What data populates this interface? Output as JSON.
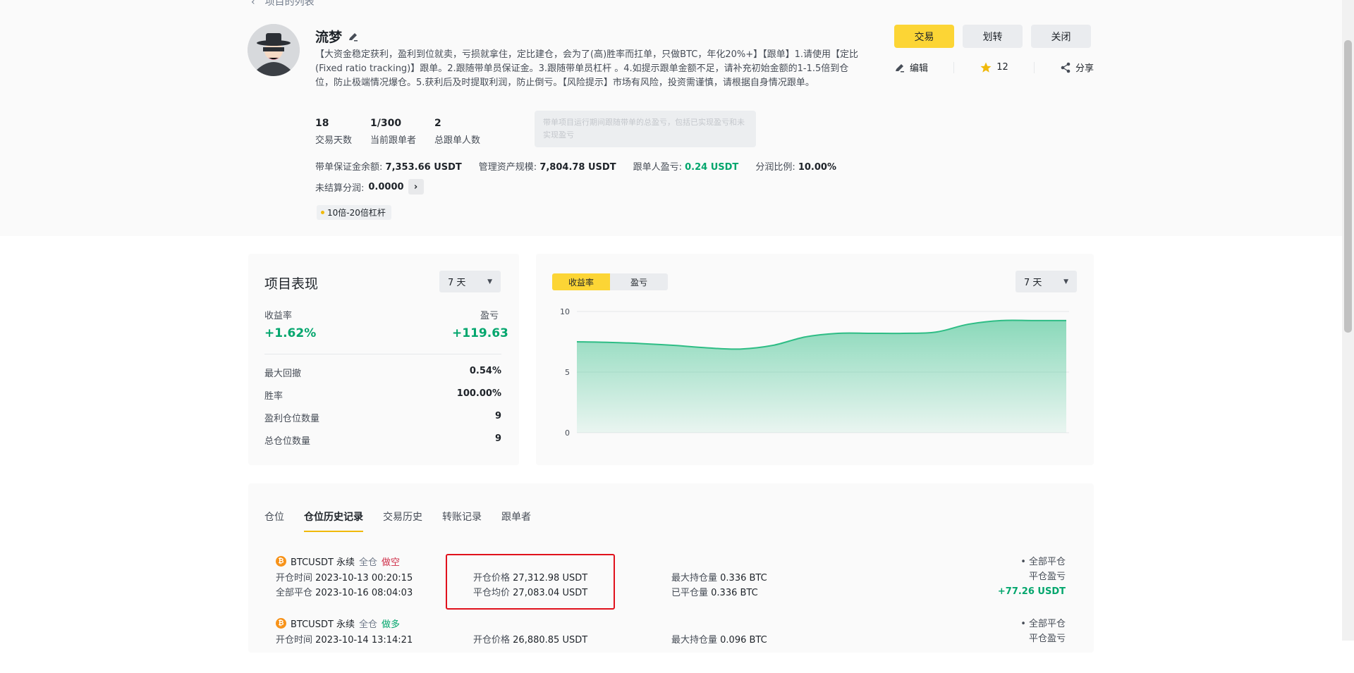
{
  "header": {
    "back_label": "项目的列表"
  },
  "profile": {
    "name": "流梦",
    "description": "【大资金稳定获利，盈利到位就卖，亏损就拿住，定比建仓，会为了(高)胜率而扛单，只做BTC，年化20%+】【跟单】1.请使用【定比(Fixed ratio tracking)】跟单。2.跟随带单员保证金。3.跟随带单员杠杆 。4.如提示跟单金额不足，请补充初始金额的1-1.5倍到仓位，防止极端情况爆仓。5.获利后及时提取利润，防止倒亏。【风险提示】市场有风险，投资需谨慎，请根据自身情况跟单。",
    "stats": [
      {
        "value": "18",
        "label": "交易天数"
      },
      {
        "value": "1/300",
        "label": "当前跟单者"
      },
      {
        "value": "2",
        "label": "总跟单人数"
      }
    ],
    "metrics": {
      "margin_label": "带单保证金余额:",
      "margin_value": "7,353.66 USDT",
      "aum_label": "管理资产规模:",
      "aum_value": "7,804.78 USDT",
      "follower_pnl_label": "跟单人盈亏:",
      "follower_pnl_value": "0.24 USDT",
      "share_label": "分润比例:",
      "share_value": "10.00%"
    },
    "pending_label": "未结算分润:",
    "pending_value": "0.0000",
    "tag": "10倍-20倍杠杆",
    "tooltip": "带单项目运行期间跟随带单的总盈亏，包括已实现盈亏和未实现盈亏"
  },
  "buttons": {
    "trade": "交易",
    "transfer": "划转",
    "close": "关闭"
  },
  "actions": {
    "edit": "编辑",
    "favorites": "12",
    "share": "分享"
  },
  "performance": {
    "title": "项目表现",
    "period": "7 天",
    "roi_label": "收益率",
    "roi_value": "+1.62%",
    "pnl_label": "盈亏",
    "pnl_value": "+119.63",
    "rows": [
      {
        "label": "最大回撤",
        "value": "0.54%"
      },
      {
        "label": "胜率",
        "value": "100.00%"
      },
      {
        "label": "盈利仓位数量",
        "value": "9"
      },
      {
        "label": "总仓位数量",
        "value": "9"
      }
    ]
  },
  "chart_panel": {
    "toggle_roi": "收益率",
    "toggle_pnl": "盈亏",
    "period": "7 天"
  },
  "chart_data": {
    "type": "area",
    "x": [
      0,
      1,
      2,
      3,
      4,
      5,
      6,
      7,
      8,
      9,
      10,
      11,
      12,
      13,
      14,
      15
    ],
    "series": [
      {
        "values": [
          7.5,
          7.45,
          7.35,
          7.2,
          7.0,
          6.9,
          7.2,
          7.9,
          8.2,
          8.2,
          8.2,
          8.3,
          8.95,
          9.25,
          9.25,
          9.25
        ]
      }
    ],
    "ylim": [
      0,
      10
    ],
    "yticks": [
      "0",
      "5",
      "10"
    ],
    "color": "#2ebd85",
    "grid": true
  },
  "tabs": [
    "仓位",
    "仓位历史记录",
    "交易历史",
    "转账记录",
    "跟单者"
  ],
  "active_tab": "仓位历史记录",
  "positions": [
    {
      "symbol": "BTCUSDT 永续",
      "margin_mode": "全仓",
      "side": "做空",
      "open_time_label": "开仓时间",
      "open_time": "2023-10-13 00:20:15",
      "close_time_label": "全部平仓",
      "close_time": "2023-10-16 08:04:03",
      "open_price_label": "开仓价格",
      "open_price": "27,312.98 USDT",
      "close_price_label": "平仓均价",
      "close_price": "27,083.04 USDT",
      "max_size_label": "最大持仓量",
      "max_size": "0.336 BTC",
      "closed_size_label": "已平仓量",
      "closed_size": "0.336 BTC",
      "status": "• 全部平仓",
      "pnl_label": "平仓盈亏",
      "pnl": "+77.26 USDT"
    },
    {
      "symbol": "BTCUSDT 永续",
      "margin_mode": "全仓",
      "side": "做多",
      "open_time_label": "开仓时间",
      "open_time": "2023-10-14 13:14:21",
      "open_price_label": "开仓价格",
      "open_price": "26,880.85 USDT",
      "max_size_label": "最大持仓量",
      "max_size": "0.096 BTC",
      "status": "• 全部平仓",
      "pnl_label": "平仓盈亏"
    }
  ]
}
